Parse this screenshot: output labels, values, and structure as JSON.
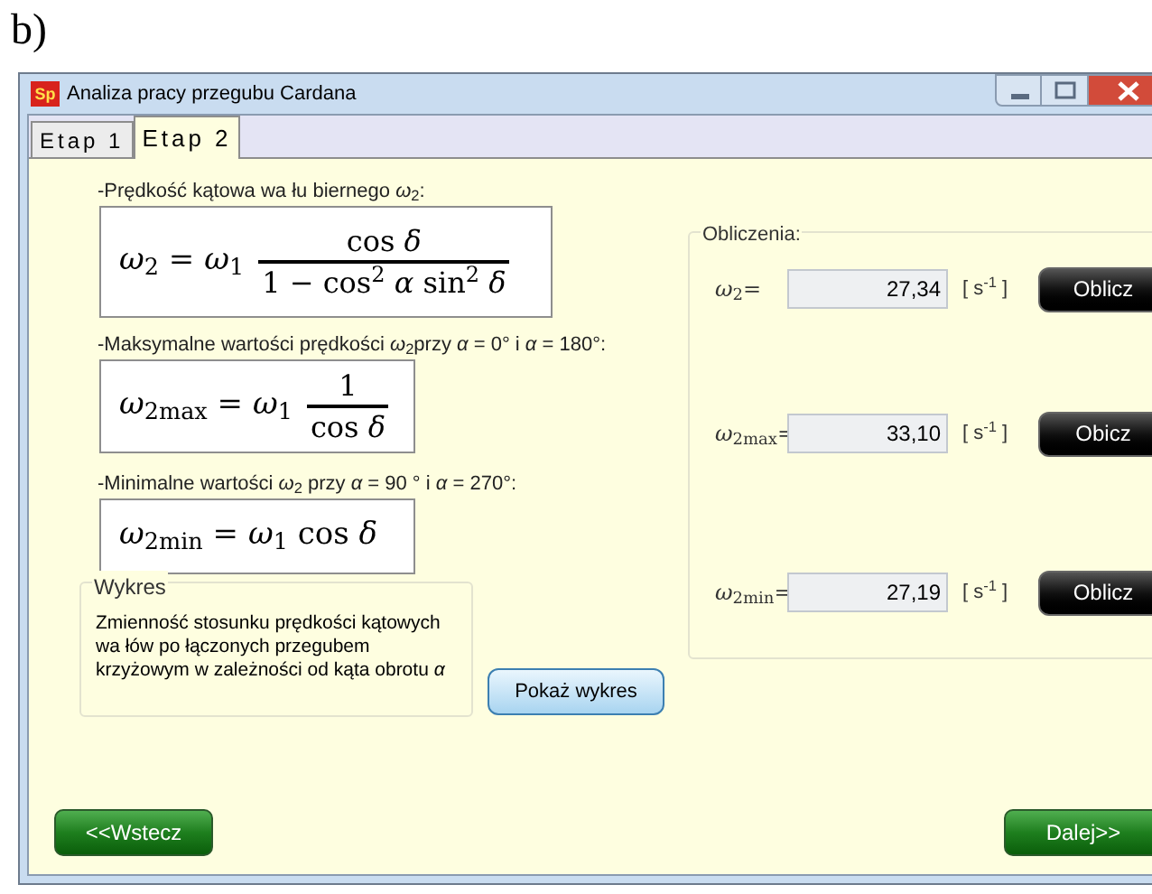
{
  "figure_label": "b)",
  "window": {
    "app_icon": "Sp",
    "title": "Analiza pracy przegubu Cardana"
  },
  "tabs": [
    {
      "label": "Etap 1",
      "selected": false
    },
    {
      "label": "Etap 2",
      "selected": true
    }
  ],
  "formulas": [
    {
      "caption": "-Prędkość kątowa wa łu biernego *ω*$_{2}$:",
      "lhs": "*ω*$_{2}$ = *ω*$_{1}$",
      "numerator": "cos *δ*",
      "denominator": "1 − cos$^{2}$ *α*  sin$^{2}$ *δ*"
    },
    {
      "caption": "-Maksymalne wartości prędkości  *ω*$_{2}$przy *α* = 0° i *α* = 180°:",
      "lhs": "*ω*$_{2max}$ = *ω*$_{1}$",
      "numerator": "1",
      "denominator": "cos *δ*"
    },
    {
      "caption": "-Minimalne wartości *ω*$_{2}$ przy *α* = 90 ° i *α* = 270°:",
      "lhs": "*ω*$_{2min}$ = *ω*$_{1}$ cos *δ*"
    }
  ],
  "chart_group": {
    "legend": "Wykres",
    "description": "Zmienność stosunku prędkości kątowych wa łów po łączonych przegubem krzyżowym w zależności od kąta obrotu *α*",
    "button": "Pokaż wykres"
  },
  "calculations": {
    "legend": "Obliczenia:",
    "rows": [
      {
        "symbol": "*ω*$_{2}$=",
        "value": "27,34",
        "unit": "[ s$^{-1}$ ]",
        "button": "Oblicz"
      },
      {
        "symbol": "*ω*$_{2max}$=",
        "value": "33,10",
        "unit": "[ s$^{-1}$ ]",
        "button": "Obicz"
      },
      {
        "symbol": "*ω*$_{2min}$=",
        "value": "27,19",
        "unit": "[ s$^{-1}$ ]",
        "button": "Oblicz"
      }
    ]
  },
  "nav": {
    "back": "<<Wstecz",
    "next": "Dalej>>"
  }
}
